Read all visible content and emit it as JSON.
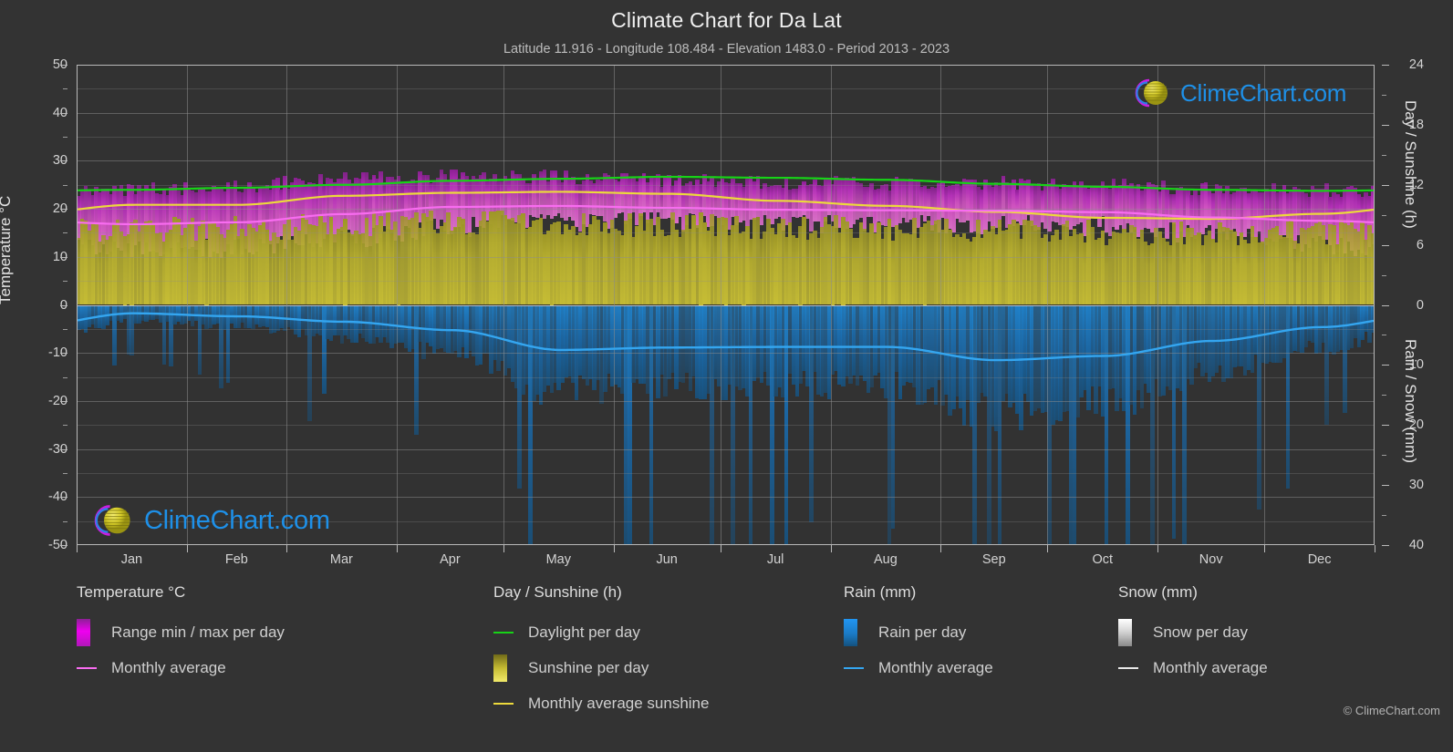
{
  "header": {
    "title": "Climate Chart for Da Lat",
    "subtitle": "Latitude 11.916 - Longitude 108.484 - Elevation 1483.0 - Period 2013 - 2023"
  },
  "footer": {
    "credit": "© ClimeChart.com"
  },
  "watermark": {
    "text": "ClimeChart.com"
  },
  "axes": {
    "left_title": "Temperature °C",
    "right_title_top": "Day / Sunshine (h)",
    "right_title_bottom": "Rain / Snow (mm)",
    "left_ticks": [
      "50",
      "40",
      "30",
      "20",
      "10",
      "0",
      "-10",
      "-20",
      "-30",
      "-40",
      "-50"
    ],
    "right_ticks_top": [
      "24",
      "18",
      "12",
      "6",
      "0"
    ],
    "right_ticks_bottom": [
      "0",
      "10",
      "20",
      "30",
      "40"
    ],
    "x_ticks": [
      "Jan",
      "Feb",
      "Mar",
      "Apr",
      "May",
      "Jun",
      "Jul",
      "Aug",
      "Sep",
      "Oct",
      "Nov",
      "Dec"
    ]
  },
  "legend": {
    "temperature": {
      "title": "Temperature °C",
      "items": [
        {
          "label": "Range min / max per day",
          "key": "swatch",
          "color": "#e600e6"
        },
        {
          "label": "Monthly average",
          "key": "line",
          "color": "#f86cf0"
        }
      ]
    },
    "day_sunshine": {
      "title": "Day / Sunshine (h)",
      "items": [
        {
          "label": "Daylight per day",
          "key": "line",
          "color": "#17d317"
        },
        {
          "label": "Sunshine per day",
          "key": "swatch",
          "color": "#ece43c"
        },
        {
          "label": "Monthly average sunshine",
          "key": "line",
          "color": "#ecd93c"
        }
      ]
    },
    "rain": {
      "title": "Rain (mm)",
      "items": [
        {
          "label": "Rain per day",
          "key": "swatch",
          "color": "#1b8fe0"
        },
        {
          "label": "Monthly average",
          "key": "line",
          "color": "#34a6f0"
        }
      ]
    },
    "snow": {
      "title": "Snow (mm)",
      "items": [
        {
          "label": "Snow per day",
          "key": "swatch",
          "color": "#e2e2e2"
        },
        {
          "label": "Monthly average",
          "key": "line",
          "color": "#e8e8e8"
        }
      ]
    }
  },
  "colors": {
    "background": "#333333",
    "plot_background": "#323232",
    "grid": "#8d8d8d",
    "daylight": "#17d317",
    "sunshine_band": "#b3ab2e",
    "sunshine_avg": "#ecd93c",
    "temp_range": "#c03ac0",
    "temp_avg": "#f86cf0",
    "rain_band": "#1b6fae",
    "rain_avg": "#34a6f0",
    "watermark_text": "#1e90e8",
    "logo_arc": "#c81ee0",
    "logo_sphere": "#d9cf2a"
  },
  "chart_data": {
    "type": "line",
    "title": "Climate Chart for Da Lat",
    "subtitle": "Latitude 11.916 - Longitude 108.484 - Elevation 1483.0 - Period 2013 - 2023",
    "xlabel": "",
    "ylabel": "Temperature °C",
    "ylim": [
      -50,
      50
    ],
    "y2lim_day": [
      0,
      24
    ],
    "y2lim_rain": [
      0,
      40
    ],
    "grid": true,
    "legend_position": "below",
    "categories": [
      "Jan",
      "Feb",
      "Mar",
      "Apr",
      "May",
      "Jun",
      "Jul",
      "Aug",
      "Sep",
      "Oct",
      "Nov",
      "Dec"
    ],
    "series": [
      {
        "name": "Monthly average temperature",
        "unit": "°C",
        "axis": "left",
        "color": "#f86cf0",
        "values": [
          16.8,
          17.2,
          18.9,
          20.4,
          20.6,
          20.2,
          19.8,
          19.7,
          19.6,
          19.3,
          18.2,
          17.5
        ]
      },
      {
        "name": "Daily temperature maximum (band top)",
        "unit": "°C",
        "axis": "left",
        "color": "#c03ac0",
        "values": [
          23.5,
          24.3,
          25.8,
          26.4,
          26.2,
          25.4,
          25.0,
          24.8,
          24.9,
          24.6,
          23.9,
          23.4
        ]
      },
      {
        "name": "Daily temperature minimum (band bottom)",
        "unit": "°C",
        "axis": "left",
        "color": "#c03ac0",
        "values": [
          11.5,
          12.0,
          14.0,
          16.3,
          17.4,
          17.5,
          17.2,
          17.1,
          17.0,
          16.6,
          14.8,
          12.8
        ]
      },
      {
        "name": "Daylight per day",
        "unit": "h",
        "axis": "right_day",
        "color": "#17d317",
        "values": [
          11.5,
          11.7,
          12.0,
          12.4,
          12.6,
          12.8,
          12.7,
          12.5,
          12.1,
          11.8,
          11.5,
          11.4
        ]
      },
      {
        "name": "Monthly average sunshine",
        "unit": "h",
        "axis": "right_day",
        "color": "#ecd93c",
        "values": [
          10.0,
          10.0,
          10.9,
          11.2,
          11.3,
          11.1,
          10.4,
          9.9,
          9.3,
          8.7,
          8.6,
          9.1
        ]
      },
      {
        "name": "Sunshine per day (band)",
        "unit": "h",
        "axis": "right_day",
        "color": "#b3ab2e",
        "values": [
          7.6,
          7.6,
          8.0,
          8.2,
          8.2,
          8.0,
          7.8,
          7.6,
          7.4,
          7.2,
          7.1,
          7.3
        ]
      },
      {
        "name": "Monthly average rain",
        "unit": "mm",
        "axis": "right_rain",
        "color": "#34a6f0",
        "values": [
          1.4,
          1.9,
          2.8,
          4.2,
          7.5,
          7.1,
          7.0,
          7.0,
          9.2,
          8.5,
          6.0,
          3.7
        ]
      },
      {
        "name": "Monthly average snow",
        "unit": "mm",
        "axis": "right_rain",
        "color": "#e8e8e8",
        "values": [
          0,
          0,
          0,
          0,
          0,
          0,
          0,
          0,
          0,
          0,
          0,
          0
        ]
      }
    ]
  }
}
